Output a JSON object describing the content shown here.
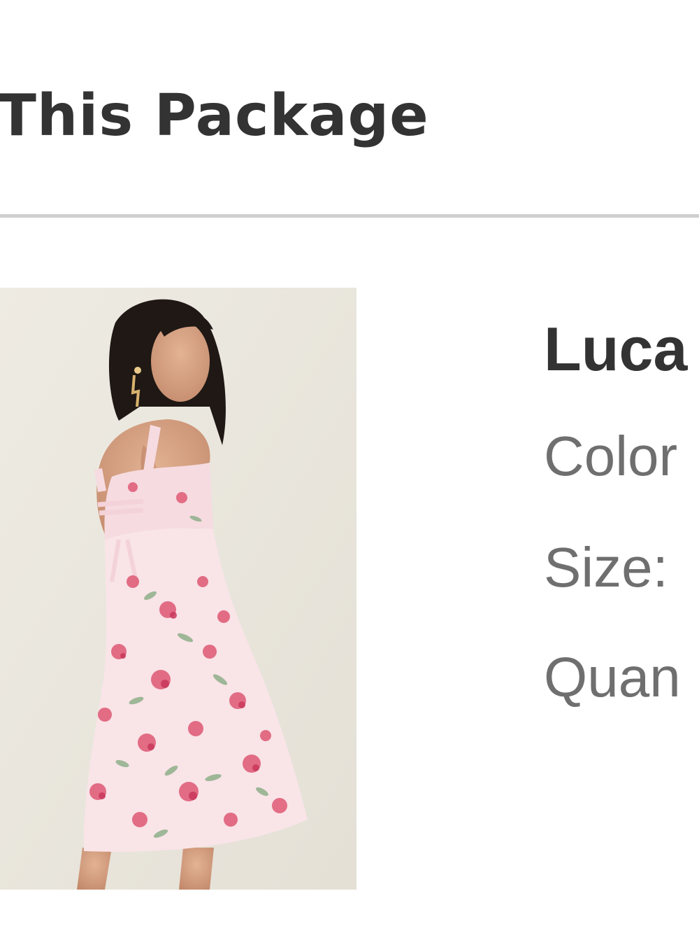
{
  "package": {
    "title": "This Package"
  },
  "item": {
    "image_alt": "Model wearing pink floral midi dress with open tie back",
    "name": "Luca",
    "color_label": "Color",
    "size_label": "Size:",
    "quantity_label": "Quan"
  },
  "colors": {
    "heading": "#333333",
    "label": "#6f6f6f",
    "divider": "#cfcfcf",
    "dress_base": "#f9e4e8",
    "flower_pink": "#e0607a",
    "leaf_green": "#8fb08a"
  }
}
